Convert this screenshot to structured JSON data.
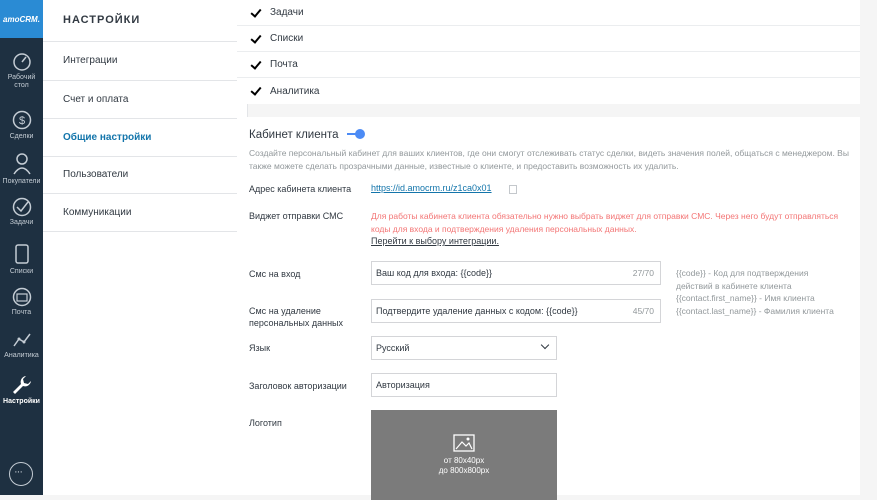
{
  "rail": {
    "logo": "amoCRM.",
    "items": [
      {
        "label": "Рабочий стол",
        "icon": "dashboard-icon"
      },
      {
        "label": "Сделки",
        "icon": "dollar-icon"
      },
      {
        "label": "Покупатели",
        "icon": "customers-icon"
      },
      {
        "label": "Задачи",
        "icon": "tasks-icon"
      },
      {
        "label": "Списки",
        "icon": "lists-icon"
      },
      {
        "label": "Почта",
        "icon": "mail-icon"
      },
      {
        "label": "Аналитика",
        "icon": "analytics-icon"
      },
      {
        "label": "Настройки",
        "icon": "wrench-icon"
      }
    ]
  },
  "menu": {
    "title": "НАСТРОЙКИ",
    "items": [
      "Интеграции",
      "Счет и оплата",
      "Общие настройки",
      "Пользователи",
      "Коммуникации"
    ],
    "active": "Общие настройки"
  },
  "checkboxes": [
    "Задачи",
    "Списки",
    "Почта",
    "Аналитика"
  ],
  "cabinet": {
    "title": "Кабинет клиента",
    "enabled": true,
    "description": "Создайте персональный кабинет для ваших клиентов, где они смогут отслеживать статус сделки, видеть значения полей, общаться с менеджером. Вы также можете сделать прозрачными данные, известные о клиенте, и предоставить возможность их удалить.",
    "address_label": "Адрес кабинета клиента",
    "address_value": "https://id.amocrm.ru/z1ca0x01",
    "sms_widget_label": "Виджет отправки СМС",
    "sms_widget_warning": "Для работы кабинета клиента обязательно нужно выбрать виджет для отправки СМС. Через него будут отправляться коды для входа и подтверждения удаления персональных данных.",
    "sms_widget_link": "Перейти к выбору интеграции.",
    "sms_login_label": "Смс на вход",
    "sms_login_value": "Ваш код для входа: {{code}}",
    "sms_login_count": "27/70",
    "sms_delete_label": "Смс на удаление персональных данных",
    "sms_delete_value": "Подтвердите удаление данных с кодом: {{code}}",
    "sms_delete_count": "45/70",
    "hint": "{{code}} - Код для подтверждения действий в кабинете клиента {{contact.first_name}} - Имя клиента {{contact.last_name}} - Фамилия клиента",
    "language_label": "Язык",
    "language_value": "Русский",
    "auth_header_label": "Заголовок авторизации",
    "auth_header_value": "Авторизация",
    "logo_label": "Логотип",
    "logo_hint_1": "от 80x40px",
    "logo_hint_2": "до 800x800px"
  }
}
